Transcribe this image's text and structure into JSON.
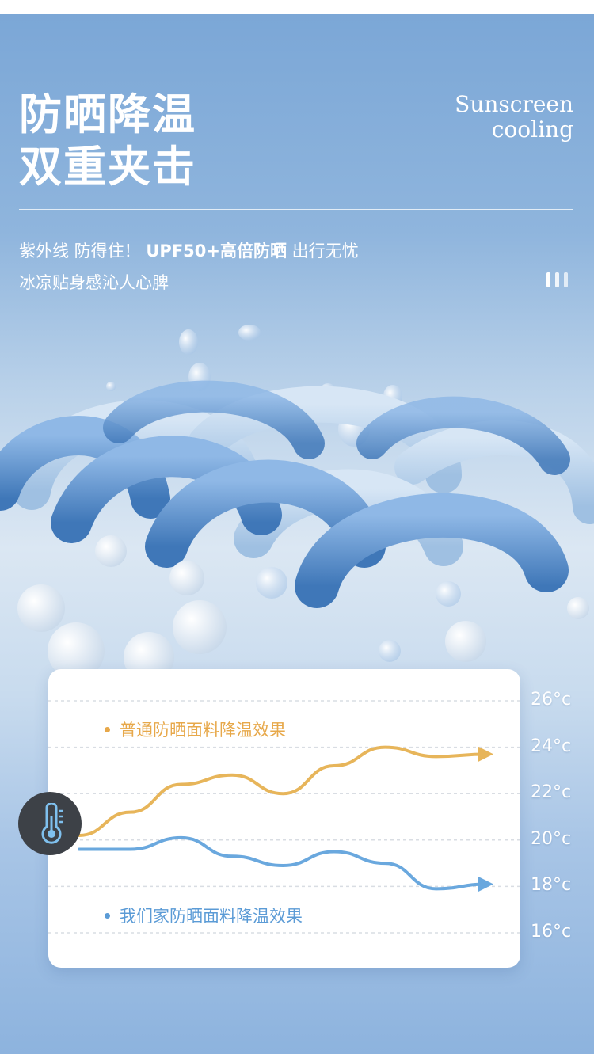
{
  "header": {
    "title_line1": "防晒降温",
    "title_line2": "双重夹击",
    "en_line1": "Sunscreen",
    "en_line2": "cooling"
  },
  "subtitle": {
    "line1_part1": "紫外线 防得住！",
    "line1_bold": "UPF50+高倍防晒",
    "line1_part2": " 出行无忧",
    "line2": "冰凉贴身感沁人心脾"
  },
  "chart_data": {
    "type": "line",
    "y_ticks": [
      "26°c",
      "24°c",
      "22°c",
      "20°c",
      "18°c",
      "16°c"
    ],
    "series": [
      {
        "name": "普通防晒面料降温效果",
        "color": "#e7b55a",
        "trend": [
          20.2,
          21.2,
          22.4,
          22.8,
          22.0,
          23.2,
          24.0,
          23.6,
          23.7
        ]
      },
      {
        "name": "我们家防晒面料降温效果",
        "color": "#6aa8de",
        "trend": [
          19.6,
          19.6,
          20.1,
          19.3,
          18.9,
          19.5,
          19.0,
          17.9,
          18.1
        ]
      }
    ]
  },
  "icons": {
    "thermometer": "thermometer-icon",
    "pause": "pause-icon"
  },
  "colors": {
    "orange": "#e7b55a",
    "blue": "#6aa8de",
    "bg": "#8db3de"
  }
}
